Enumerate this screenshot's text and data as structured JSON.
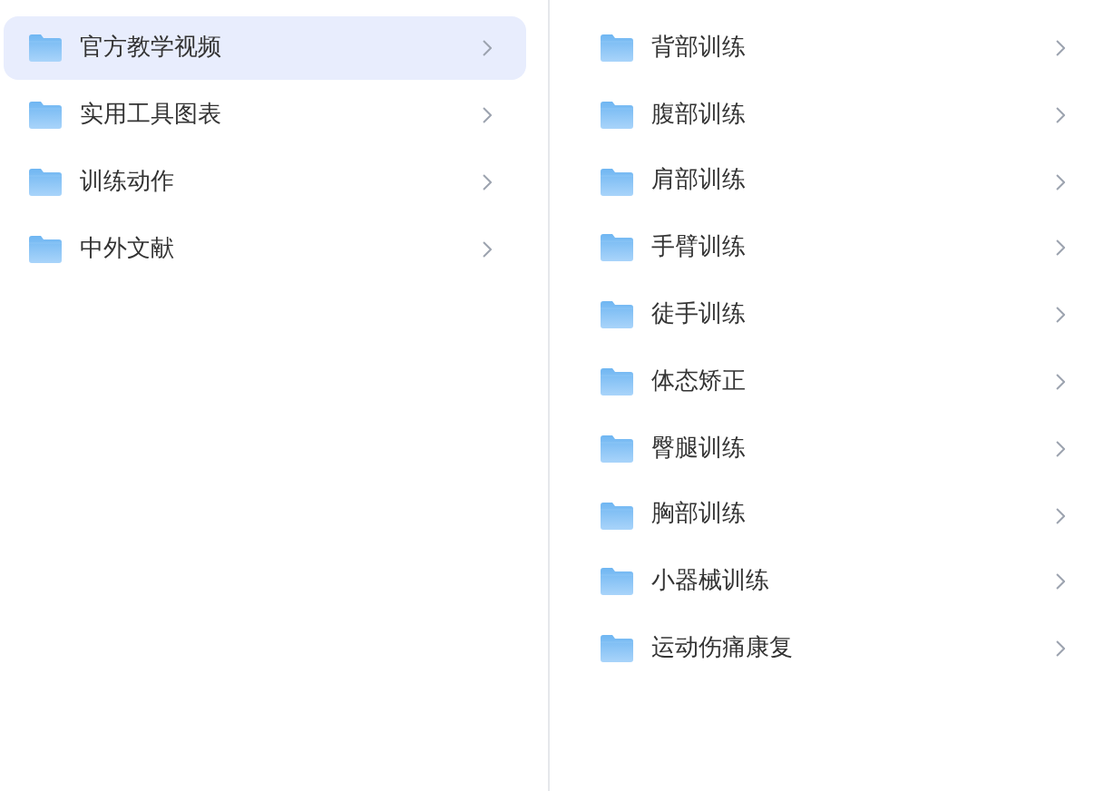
{
  "categories": [
    {
      "label": "官方教学视频",
      "selected": true
    },
    {
      "label": "实用工具图表",
      "selected": false
    },
    {
      "label": "训练动作",
      "selected": false
    },
    {
      "label": "中外文献",
      "selected": false
    }
  ],
  "subcategories": [
    {
      "label": "背部训练"
    },
    {
      "label": "腹部训练"
    },
    {
      "label": "肩部训练"
    },
    {
      "label": "手臂训练"
    },
    {
      "label": "徒手训练"
    },
    {
      "label": "体态矫正"
    },
    {
      "label": "臀腿训练"
    },
    {
      "label": "胸部训练"
    },
    {
      "label": "小器械训练"
    },
    {
      "label": "运动伤痛康复"
    }
  ]
}
